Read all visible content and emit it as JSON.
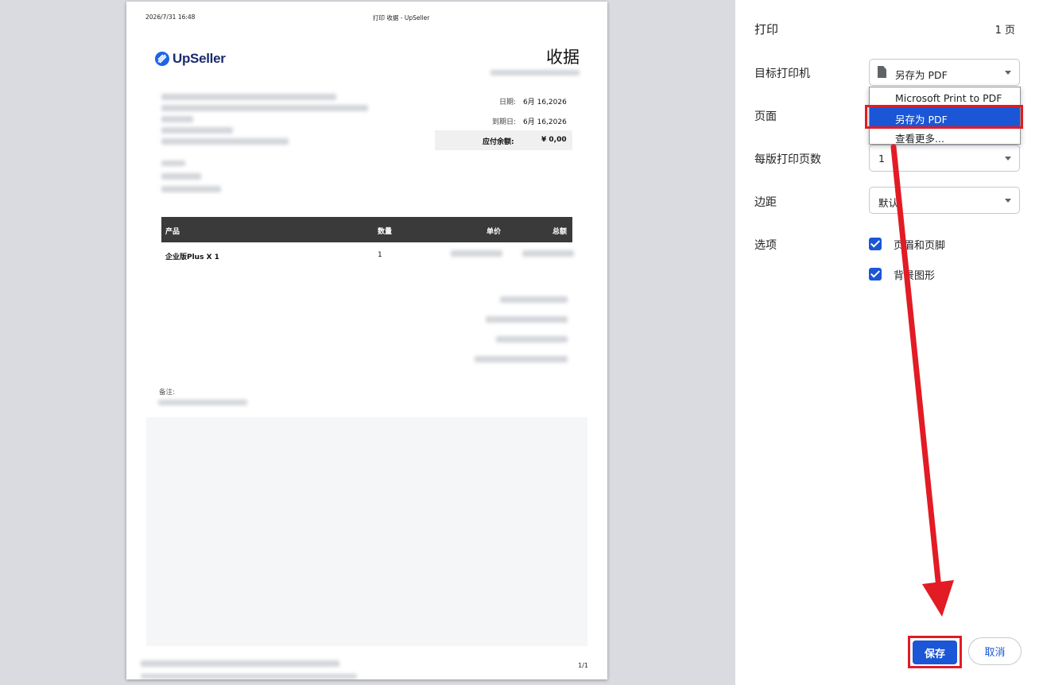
{
  "preview": {
    "header_datetime": "2026/7/31 16:48",
    "header_title": "打印 收据 - UpSeller",
    "brand": "UpSeller",
    "doc_title": "收据",
    "date_label": "日期:",
    "date_value": "6月 16,2026",
    "due_label": "到期日:",
    "due_value": "6月 16,2026",
    "amount_due_label": "应付余额:",
    "amount_due_value": "¥ 0,00",
    "table_headers": {
      "product": "产品",
      "qty": "数量",
      "price": "单价",
      "total": "总额"
    },
    "items": [
      {
        "product": "企业版Plus X 1",
        "qty": "1"
      }
    ],
    "notes_label": "备注:",
    "page_number": "1/1"
  },
  "panel": {
    "title": "打印",
    "page_count": "1 页",
    "printer_label": "目标打印机",
    "printer_value": "另存为 PDF",
    "printer_options": [
      "Microsoft Print to PDF",
      "另存为 PDF",
      "查看更多..."
    ],
    "pages_label": "页面",
    "pages_per_sheet_label": "每版打印页数",
    "pages_per_sheet_value": "1",
    "margins_label": "边距",
    "margins_value": "默认",
    "options_label": "选项",
    "option_headers_footers": "页眉和页脚",
    "option_background": "背景图形",
    "save_label": "保存",
    "cancel_label": "取消"
  },
  "colors": {
    "accent": "#1a56d6",
    "annotation": "#e21b24",
    "table_header": "#3a3a3a"
  }
}
